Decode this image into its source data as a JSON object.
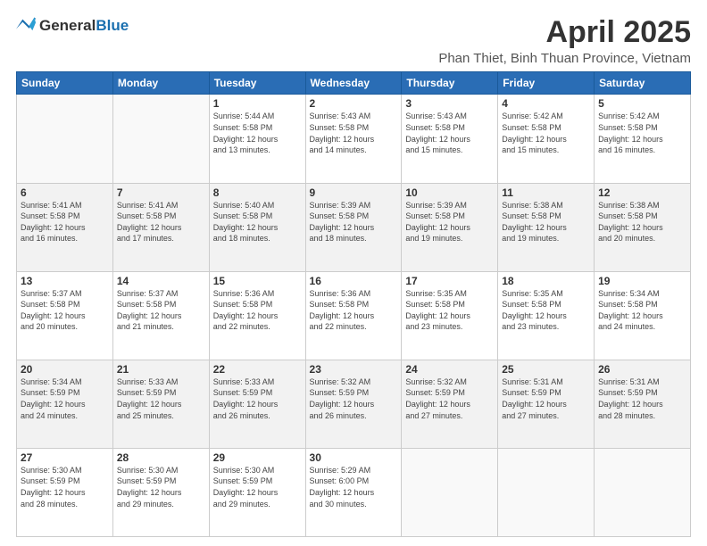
{
  "header": {
    "logo_general": "General",
    "logo_blue": "Blue",
    "month_title": "April 2025",
    "location": "Phan Thiet, Binh Thuan Province, Vietnam"
  },
  "days_of_week": [
    "Sunday",
    "Monday",
    "Tuesday",
    "Wednesday",
    "Thursday",
    "Friday",
    "Saturday"
  ],
  "weeks": [
    [
      {
        "day": "",
        "info": ""
      },
      {
        "day": "",
        "info": ""
      },
      {
        "day": "1",
        "info": "Sunrise: 5:44 AM\nSunset: 5:58 PM\nDaylight: 12 hours\nand 13 minutes."
      },
      {
        "day": "2",
        "info": "Sunrise: 5:43 AM\nSunset: 5:58 PM\nDaylight: 12 hours\nand 14 minutes."
      },
      {
        "day": "3",
        "info": "Sunrise: 5:43 AM\nSunset: 5:58 PM\nDaylight: 12 hours\nand 15 minutes."
      },
      {
        "day": "4",
        "info": "Sunrise: 5:42 AM\nSunset: 5:58 PM\nDaylight: 12 hours\nand 15 minutes."
      },
      {
        "day": "5",
        "info": "Sunrise: 5:42 AM\nSunset: 5:58 PM\nDaylight: 12 hours\nand 16 minutes."
      }
    ],
    [
      {
        "day": "6",
        "info": "Sunrise: 5:41 AM\nSunset: 5:58 PM\nDaylight: 12 hours\nand 16 minutes."
      },
      {
        "day": "7",
        "info": "Sunrise: 5:41 AM\nSunset: 5:58 PM\nDaylight: 12 hours\nand 17 minutes."
      },
      {
        "day": "8",
        "info": "Sunrise: 5:40 AM\nSunset: 5:58 PM\nDaylight: 12 hours\nand 18 minutes."
      },
      {
        "day": "9",
        "info": "Sunrise: 5:39 AM\nSunset: 5:58 PM\nDaylight: 12 hours\nand 18 minutes."
      },
      {
        "day": "10",
        "info": "Sunrise: 5:39 AM\nSunset: 5:58 PM\nDaylight: 12 hours\nand 19 minutes."
      },
      {
        "day": "11",
        "info": "Sunrise: 5:38 AM\nSunset: 5:58 PM\nDaylight: 12 hours\nand 19 minutes."
      },
      {
        "day": "12",
        "info": "Sunrise: 5:38 AM\nSunset: 5:58 PM\nDaylight: 12 hours\nand 20 minutes."
      }
    ],
    [
      {
        "day": "13",
        "info": "Sunrise: 5:37 AM\nSunset: 5:58 PM\nDaylight: 12 hours\nand 20 minutes."
      },
      {
        "day": "14",
        "info": "Sunrise: 5:37 AM\nSunset: 5:58 PM\nDaylight: 12 hours\nand 21 minutes."
      },
      {
        "day": "15",
        "info": "Sunrise: 5:36 AM\nSunset: 5:58 PM\nDaylight: 12 hours\nand 22 minutes."
      },
      {
        "day": "16",
        "info": "Sunrise: 5:36 AM\nSunset: 5:58 PM\nDaylight: 12 hours\nand 22 minutes."
      },
      {
        "day": "17",
        "info": "Sunrise: 5:35 AM\nSunset: 5:58 PM\nDaylight: 12 hours\nand 23 minutes."
      },
      {
        "day": "18",
        "info": "Sunrise: 5:35 AM\nSunset: 5:58 PM\nDaylight: 12 hours\nand 23 minutes."
      },
      {
        "day": "19",
        "info": "Sunrise: 5:34 AM\nSunset: 5:58 PM\nDaylight: 12 hours\nand 24 minutes."
      }
    ],
    [
      {
        "day": "20",
        "info": "Sunrise: 5:34 AM\nSunset: 5:59 PM\nDaylight: 12 hours\nand 24 minutes."
      },
      {
        "day": "21",
        "info": "Sunrise: 5:33 AM\nSunset: 5:59 PM\nDaylight: 12 hours\nand 25 minutes."
      },
      {
        "day": "22",
        "info": "Sunrise: 5:33 AM\nSunset: 5:59 PM\nDaylight: 12 hours\nand 26 minutes."
      },
      {
        "day": "23",
        "info": "Sunrise: 5:32 AM\nSunset: 5:59 PM\nDaylight: 12 hours\nand 26 minutes."
      },
      {
        "day": "24",
        "info": "Sunrise: 5:32 AM\nSunset: 5:59 PM\nDaylight: 12 hours\nand 27 minutes."
      },
      {
        "day": "25",
        "info": "Sunrise: 5:31 AM\nSunset: 5:59 PM\nDaylight: 12 hours\nand 27 minutes."
      },
      {
        "day": "26",
        "info": "Sunrise: 5:31 AM\nSunset: 5:59 PM\nDaylight: 12 hours\nand 28 minutes."
      }
    ],
    [
      {
        "day": "27",
        "info": "Sunrise: 5:30 AM\nSunset: 5:59 PM\nDaylight: 12 hours\nand 28 minutes."
      },
      {
        "day": "28",
        "info": "Sunrise: 5:30 AM\nSunset: 5:59 PM\nDaylight: 12 hours\nand 29 minutes."
      },
      {
        "day": "29",
        "info": "Sunrise: 5:30 AM\nSunset: 5:59 PM\nDaylight: 12 hours\nand 29 minutes."
      },
      {
        "day": "30",
        "info": "Sunrise: 5:29 AM\nSunset: 6:00 PM\nDaylight: 12 hours\nand 30 minutes."
      },
      {
        "day": "",
        "info": ""
      },
      {
        "day": "",
        "info": ""
      },
      {
        "day": "",
        "info": ""
      }
    ]
  ]
}
